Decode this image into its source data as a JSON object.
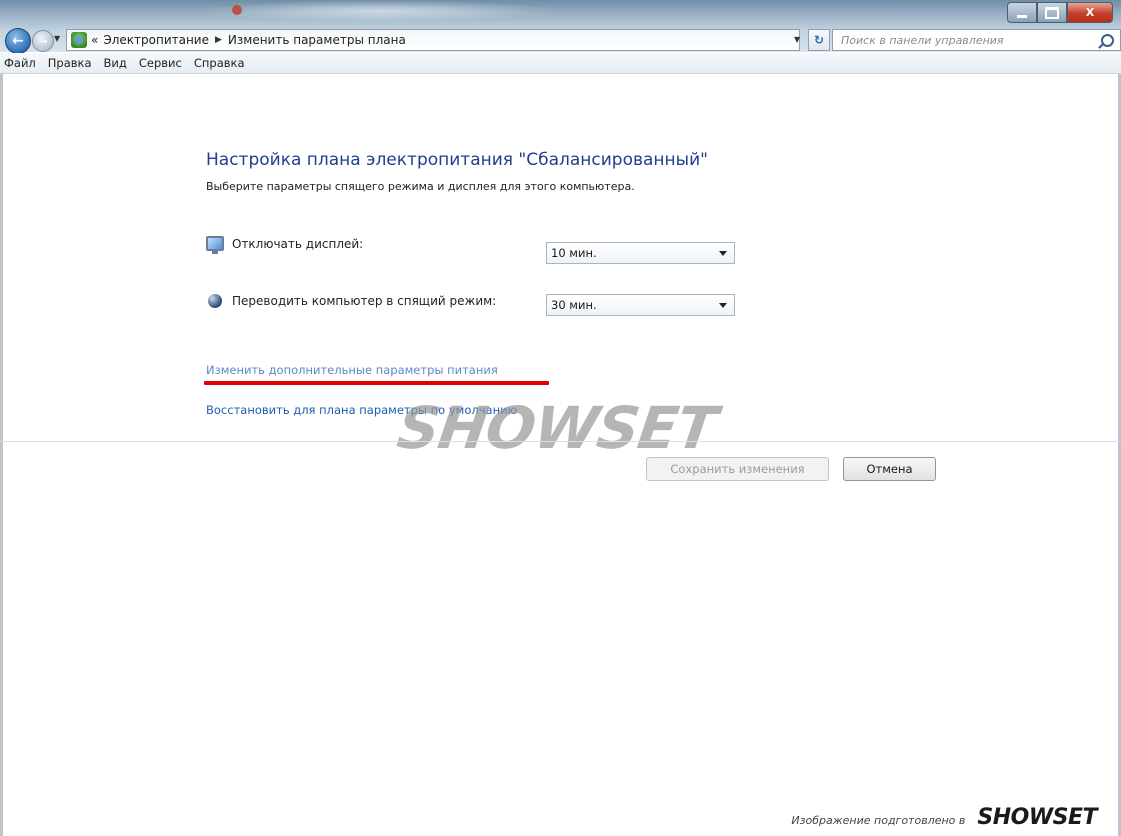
{
  "window": {
    "controls": {
      "minimize": "",
      "maximize": "",
      "close": "X"
    }
  },
  "address": {
    "prefix": "«",
    "crumbs": [
      "Электропитание",
      "Изменить параметры плана"
    ]
  },
  "search": {
    "placeholder": "Поиск в панели управления"
  },
  "menu": [
    "Файл",
    "Правка",
    "Вид",
    "Сервис",
    "Справка"
  ],
  "plan": {
    "title": "Настройка плана электропитания \"Сбалансированный\"",
    "subtitle": "Выберите параметры спящего режима и дисплея для этого компьютера.",
    "display_label": "Отключать дисплей:",
    "display_value": "10 мин.",
    "sleep_label": "Переводить компьютер в спящий режим:",
    "sleep_value": "30 мин."
  },
  "links": {
    "advanced": "Изменить дополнительные параметры питания",
    "restore": "Восстановить для плана параметры по умолчанию"
  },
  "watermark": "SHOWSET",
  "buttons": {
    "save": "Сохранить изменения",
    "cancel": "Отмена"
  },
  "footer": {
    "note": "Изображение подготовлено в",
    "brand": "SHOWSET"
  },
  "colors": {
    "heading": "#1e3f8f",
    "link": "#1f5cb0",
    "highlight": "#e00000"
  }
}
